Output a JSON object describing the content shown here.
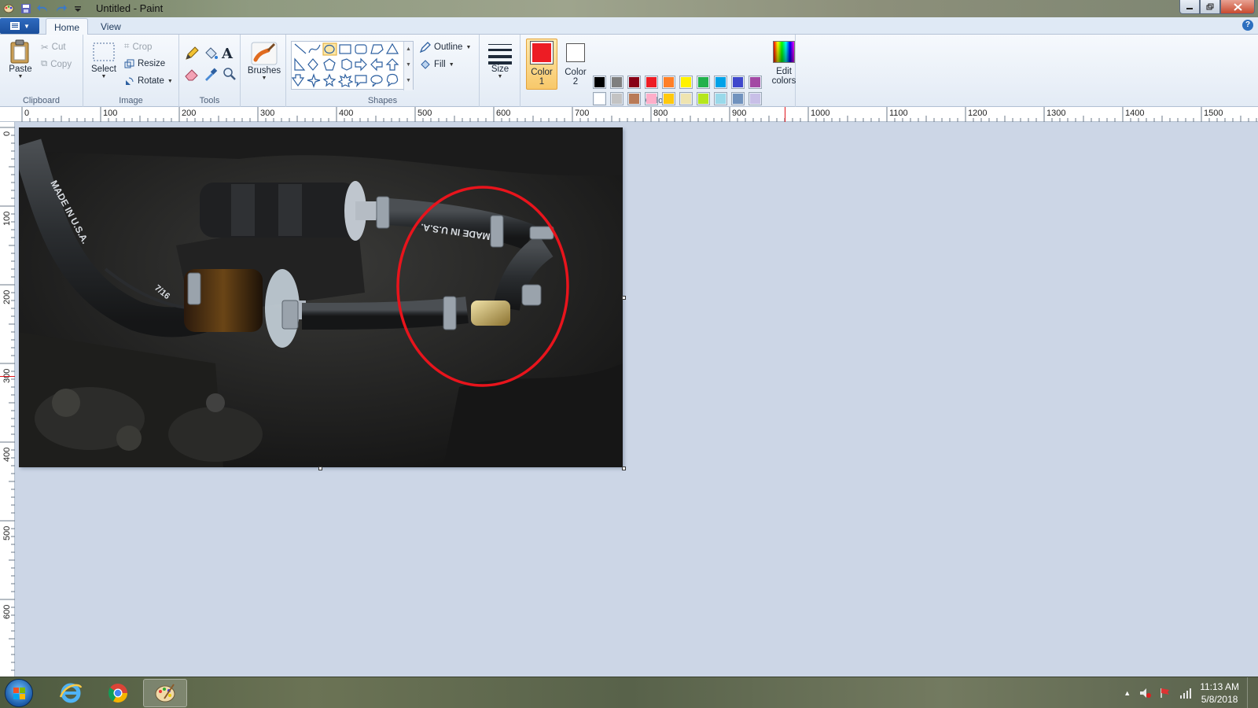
{
  "window": {
    "title": "Untitled - Paint"
  },
  "tabs": [
    {
      "label": "Home"
    },
    {
      "label": "View"
    }
  ],
  "ribbon": {
    "clipboard": {
      "label": "Clipboard",
      "paste": "Paste",
      "cut": "Cut",
      "copy": "Copy"
    },
    "image": {
      "label": "Image",
      "select": "Select",
      "crop": "Crop",
      "resize": "Resize",
      "rotate": "Rotate"
    },
    "tools": {
      "label": "Tools"
    },
    "brushes": {
      "label": "Brushes"
    },
    "shapes": {
      "label": "Shapes",
      "outline": "Outline",
      "fill": "Fill"
    },
    "size": {
      "label": "Size"
    },
    "colors": {
      "label": "Colors",
      "color1": "Color",
      "color1_num": "1",
      "color2": "Color",
      "color2_num": "2",
      "edit": "Edit",
      "edit2": "colors",
      "color1_value": "#ed1c24",
      "color2_value": "#ffffff",
      "palette_row1": [
        "#000000",
        "#7f7f7f",
        "#880015",
        "#ed1c24",
        "#ff7f27",
        "#fff200",
        "#22b14c",
        "#00a2e8",
        "#3f48cc",
        "#a349a4"
      ],
      "palette_row2": [
        "#ffffff",
        "#c3c3c3",
        "#b97a57",
        "#ffaec9",
        "#ffc90e",
        "#efe4b0",
        "#b5e61d",
        "#99d9ea",
        "#7092be",
        "#c8bfe7"
      ]
    }
  },
  "rulers": {
    "horizontal": [
      "0",
      "100",
      "200",
      "300",
      "400",
      "500",
      "600",
      "700",
      "800",
      "900",
      "1000",
      "1100",
      "1200",
      "1300",
      "1400",
      "1500"
    ],
    "vertical": [
      "0",
      "100",
      "200",
      "300",
      "400",
      "500",
      "600"
    ]
  },
  "canvas": {
    "annotation_color": "#e8141c",
    "hose_text_1": "MADE IN U.S.A.",
    "hose_text_2": "MADE IN U.S.A.",
    "hose_text_3": "7/16"
  },
  "taskbar": {
    "time": "11:13 AM",
    "date": "5/8/2018"
  }
}
